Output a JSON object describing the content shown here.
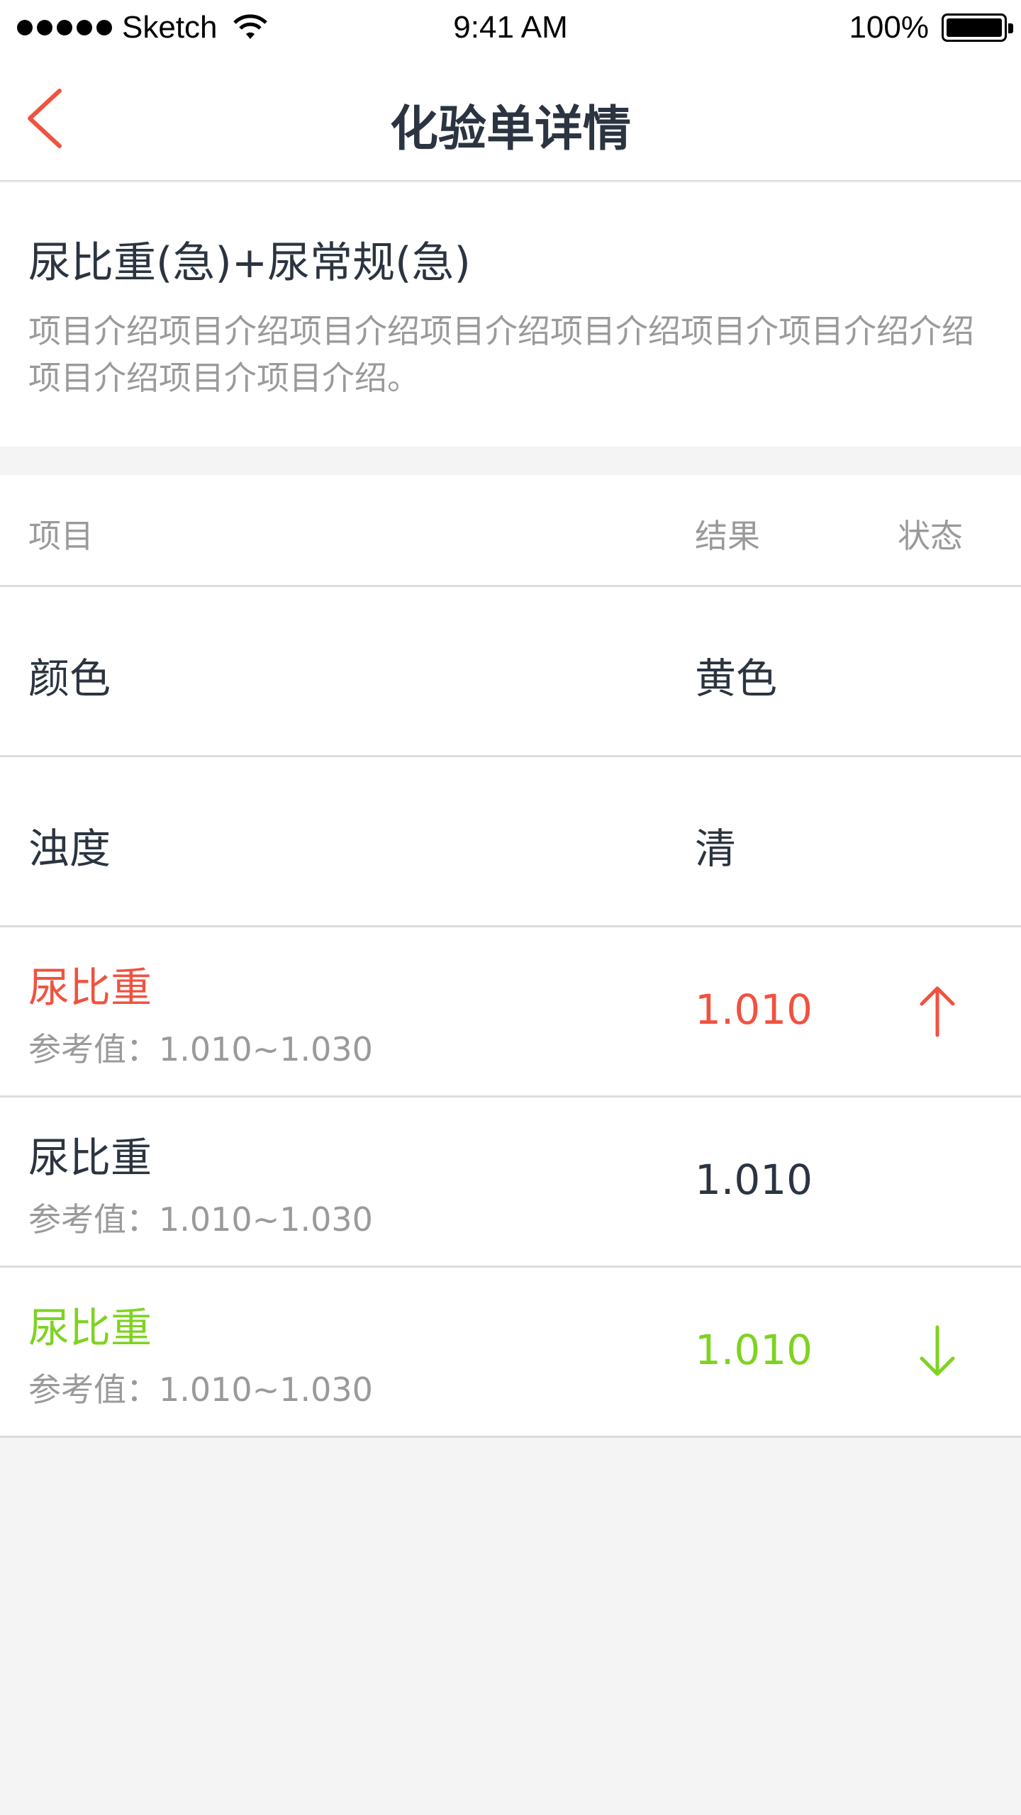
{
  "status_bar": {
    "carrier": "Sketch",
    "time": "9:41 AM",
    "battery": "100%"
  },
  "nav": {
    "title": "化验单详情"
  },
  "intro": {
    "title": "尿比重(急)+尿常规(急)",
    "description": "项目介绍项目介绍项目介绍项目介绍项目介绍项目介项目介绍介绍项目介绍项目介项目介绍。"
  },
  "table": {
    "headers": {
      "name": "项目",
      "result": "结果",
      "status": "状态"
    },
    "rows": [
      {
        "name": "颜色",
        "result": "黄色"
      },
      {
        "name": "浊度",
        "result": "清"
      },
      {
        "name": "尿比重",
        "reference": "参考值：1.010~1.030",
        "result": "1.010",
        "status": "up-arrow-icon",
        "color": "#f05240"
      },
      {
        "name": "尿比重",
        "reference": "参考值：1.010~1.030",
        "result": "1.010",
        "color": "#2b3440"
      },
      {
        "name": "尿比重",
        "reference": "参考值：1.010~1.030",
        "result": "1.010",
        "status": "down-arrow-icon",
        "color": "#7ed321"
      }
    ]
  },
  "colors": {
    "accent": "#f05240",
    "high": "#f05240",
    "low": "#7ed321",
    "text": "#2b3440",
    "muted": "#9a9a9a",
    "background": "#f4f4f4"
  }
}
